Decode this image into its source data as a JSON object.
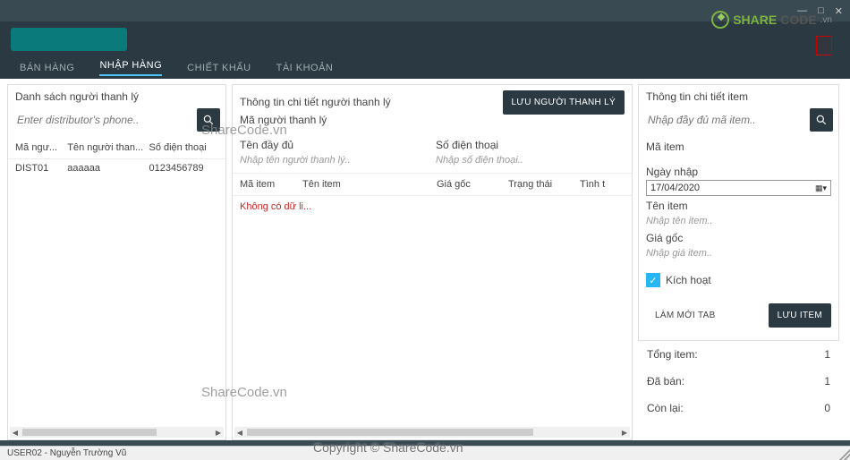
{
  "titlebar": {
    "min": "—",
    "max": "□",
    "close": "✕"
  },
  "logo": {
    "brand1": "SHARE",
    "brand2": "CODE",
    "suffix": ".vn"
  },
  "tabs": [
    "BÁN HÀNG",
    "NHẬP HÀNG",
    "CHIẾT KHẤU",
    "TÀI KHOẢN"
  ],
  "active_tab": 1,
  "left": {
    "title": "Danh sách người thanh lý",
    "search_placeholder": "Enter distributor's phone..",
    "cols": [
      "Mã ngư...",
      "Tên người than...",
      "Số điện thoại"
    ],
    "rows": [
      {
        "id": "DIST01",
        "name": "aaaaaa",
        "phone": "0123456789"
      }
    ]
  },
  "mid": {
    "title": "Thông tin chi tiết người thanh lý",
    "code_label": "Mã người thanh lý",
    "save_btn": "LƯU NGƯỜI THANH LÝ",
    "fullname_label": "Tên đầy đủ",
    "fullname_placeholder": "Nhập tên người thanh lý..",
    "phone_label": "Số điện thoại",
    "phone_placeholder": "Nhập số điện thoại..",
    "item_cols": [
      "Mã item",
      "Tên item",
      "Giá gốc",
      "Trạng thái",
      "Tình t"
    ],
    "empty": "Không có dữ li..."
  },
  "right": {
    "title": "Thông tin chi tiết item",
    "search_placeholder": "Nhập đầy đủ mã item..",
    "code_label": "Mã item",
    "date_label": "Ngày nhập",
    "date_value": "17/04/2020",
    "name_label": "Tên item",
    "name_placeholder": "Nhập tên item..",
    "price_label": "Giá gốc",
    "price_placeholder": "Nhập giá item..",
    "active_label": "Kích hoạt",
    "reset_btn": "LÀM MỚI TAB",
    "save_btn": "LƯU ITEM",
    "stats": {
      "total_label": "Tổng item:",
      "total_value": "1",
      "sold_label": "Đã bán:",
      "sold_value": "1",
      "remain_label": "Còn lại:",
      "remain_value": "0"
    }
  },
  "statusbar": "USER02 - Nguyễn Trường Vũ",
  "watermarks": {
    "w1": "ShareCode.vn",
    "w2": "ShareCode.vn",
    "w3": "Copyright © ShareCode.vn"
  }
}
